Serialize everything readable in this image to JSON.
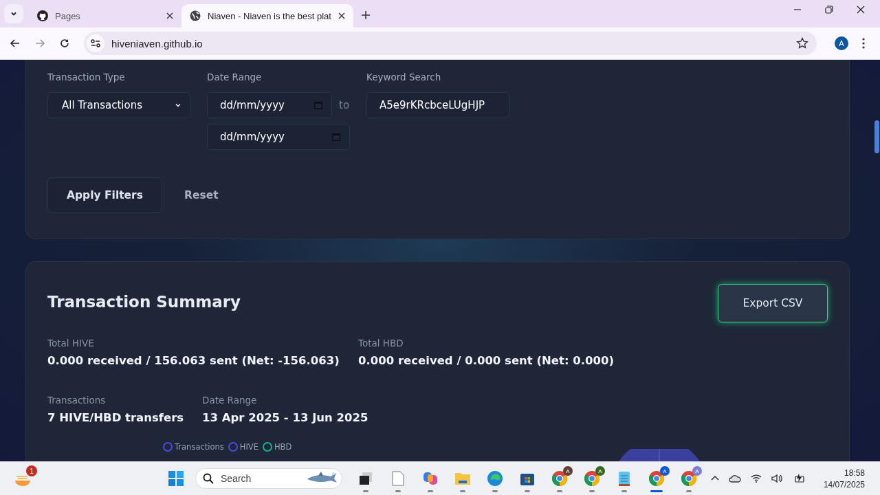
{
  "browser": {
    "tabs": [
      {
        "title": "Pages",
        "selected": false
      },
      {
        "title": "Niaven - Niaven is the best plat",
        "selected": true
      }
    ],
    "url": "hiveniaven.github.io",
    "profile": "A"
  },
  "filters": {
    "type_label": "Transaction Type",
    "type_value": "All Transactions",
    "date_label": "Date Range",
    "date_from": "dd/mm/yyyy",
    "date_to": "dd/mm/yyyy",
    "to": "to",
    "keyword_label": "Keyword Search",
    "keyword_value": "A5e9rKRcbceLUgHJP",
    "apply": "Apply Filters",
    "reset": "Reset"
  },
  "summary": {
    "title": "Transaction Summary",
    "export": "Export CSV",
    "stats": [
      {
        "label": "Total HIVE",
        "value": "0.000 received / 156.063 sent (Net: -156.063)"
      },
      {
        "label": "Total HBD",
        "value": "0.000 received / 0.000 sent (Net: 0.000)"
      },
      {
        "label": "Transactions",
        "value": "7 HIVE/HBD transfers"
      },
      {
        "label": "Date Range",
        "value": "13 Apr 2025 - 13 Jun 2025"
      }
    ],
    "legend": [
      {
        "label": "Transactions",
        "color": "#4f46e5"
      },
      {
        "label": "HIVE",
        "color": "#4f46e5"
      },
      {
        "label": "HBD",
        "color": "#10b981"
      }
    ]
  },
  "taskbar": {
    "badge": "1",
    "search": "Search",
    "apps": [
      {
        "kind": "taskview",
        "active": false
      },
      {
        "kind": "file",
        "active": false
      },
      {
        "kind": "copilot",
        "active": false
      },
      {
        "kind": "folder",
        "active": false
      },
      {
        "kind": "edge",
        "active": false
      },
      {
        "kind": "store",
        "active": false
      },
      {
        "kind": "chrome",
        "letter": "A",
        "color": "#5d4037",
        "active": false
      },
      {
        "kind": "chrome",
        "letter": "A",
        "color": "#33691e",
        "active": false
      },
      {
        "kind": "notepad",
        "active": false
      },
      {
        "kind": "chrome",
        "letter": "A",
        "color": "#0b57d0",
        "active": true
      },
      {
        "kind": "chrome",
        "letter": "A",
        "color": "#7b7fd6",
        "active": false
      }
    ],
    "time": "18:58",
    "date": "14/07/2025"
  }
}
